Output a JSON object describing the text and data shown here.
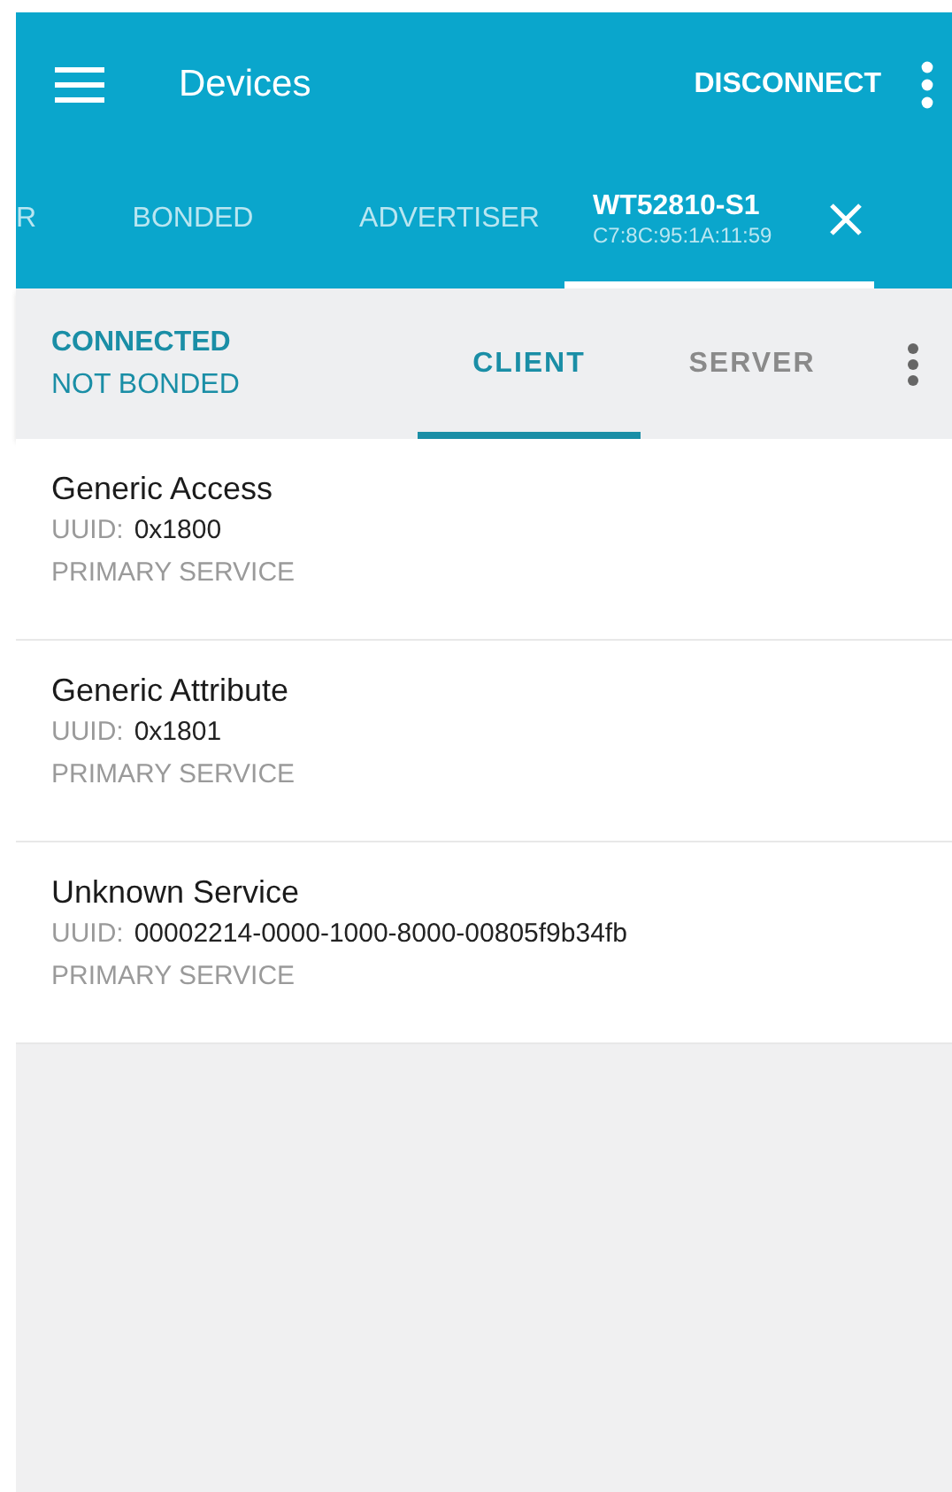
{
  "app_bar": {
    "title": "Devices",
    "action": "DISCONNECT"
  },
  "device_tabs": [
    {
      "label": "R",
      "selected": false
    },
    {
      "label": "BONDED",
      "selected": false
    },
    {
      "label": "ADVERTISER",
      "selected": false
    },
    {
      "label": "WT52810-S1",
      "address": "C7:8C:95:1A:11:59",
      "selected": true
    }
  ],
  "connection": {
    "state": "CONNECTED",
    "bond": "NOT BONDED"
  },
  "role_tabs": [
    {
      "label": "CLIENT",
      "selected": true
    },
    {
      "label": "SERVER",
      "selected": false
    }
  ],
  "services": [
    {
      "name": "Generic Access",
      "uuid_label": "UUID:",
      "uuid": "0x1800",
      "type": "PRIMARY SERVICE"
    },
    {
      "name": "Generic Attribute",
      "uuid_label": "UUID:",
      "uuid": "0x1801",
      "type": "PRIMARY SERVICE"
    },
    {
      "name": "Unknown Service",
      "uuid_label": "UUID:",
      "uuid": "00002214-0000-1000-8000-00805f9b34fb",
      "type": "PRIMARY SERVICE"
    }
  ]
}
